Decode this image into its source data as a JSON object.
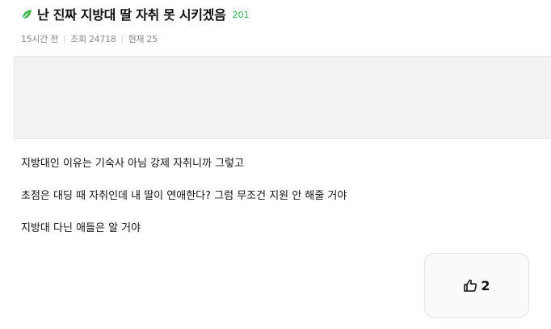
{
  "post": {
    "title": "난 진짜 지방대 딸 자취 못 시키겠음",
    "comment_count": "201",
    "icon": "leaf-icon",
    "accent_color": "#2bb24c"
  },
  "meta": {
    "time": "15시간 전",
    "views": "조회 24718",
    "current": "현재 25"
  },
  "content": {
    "lines": [
      "지방대인 이유는 기숙사 아님 강제 자취니까 그렇고",
      "초점은 대딩 때 자취인데 내 딸이 연애한다? 그럼 무조건 지원 안 해줄 거야",
      "지방대 다닌 애들은 알 거야"
    ]
  },
  "like": {
    "icon": "thumbs-up-icon",
    "count": "2"
  }
}
